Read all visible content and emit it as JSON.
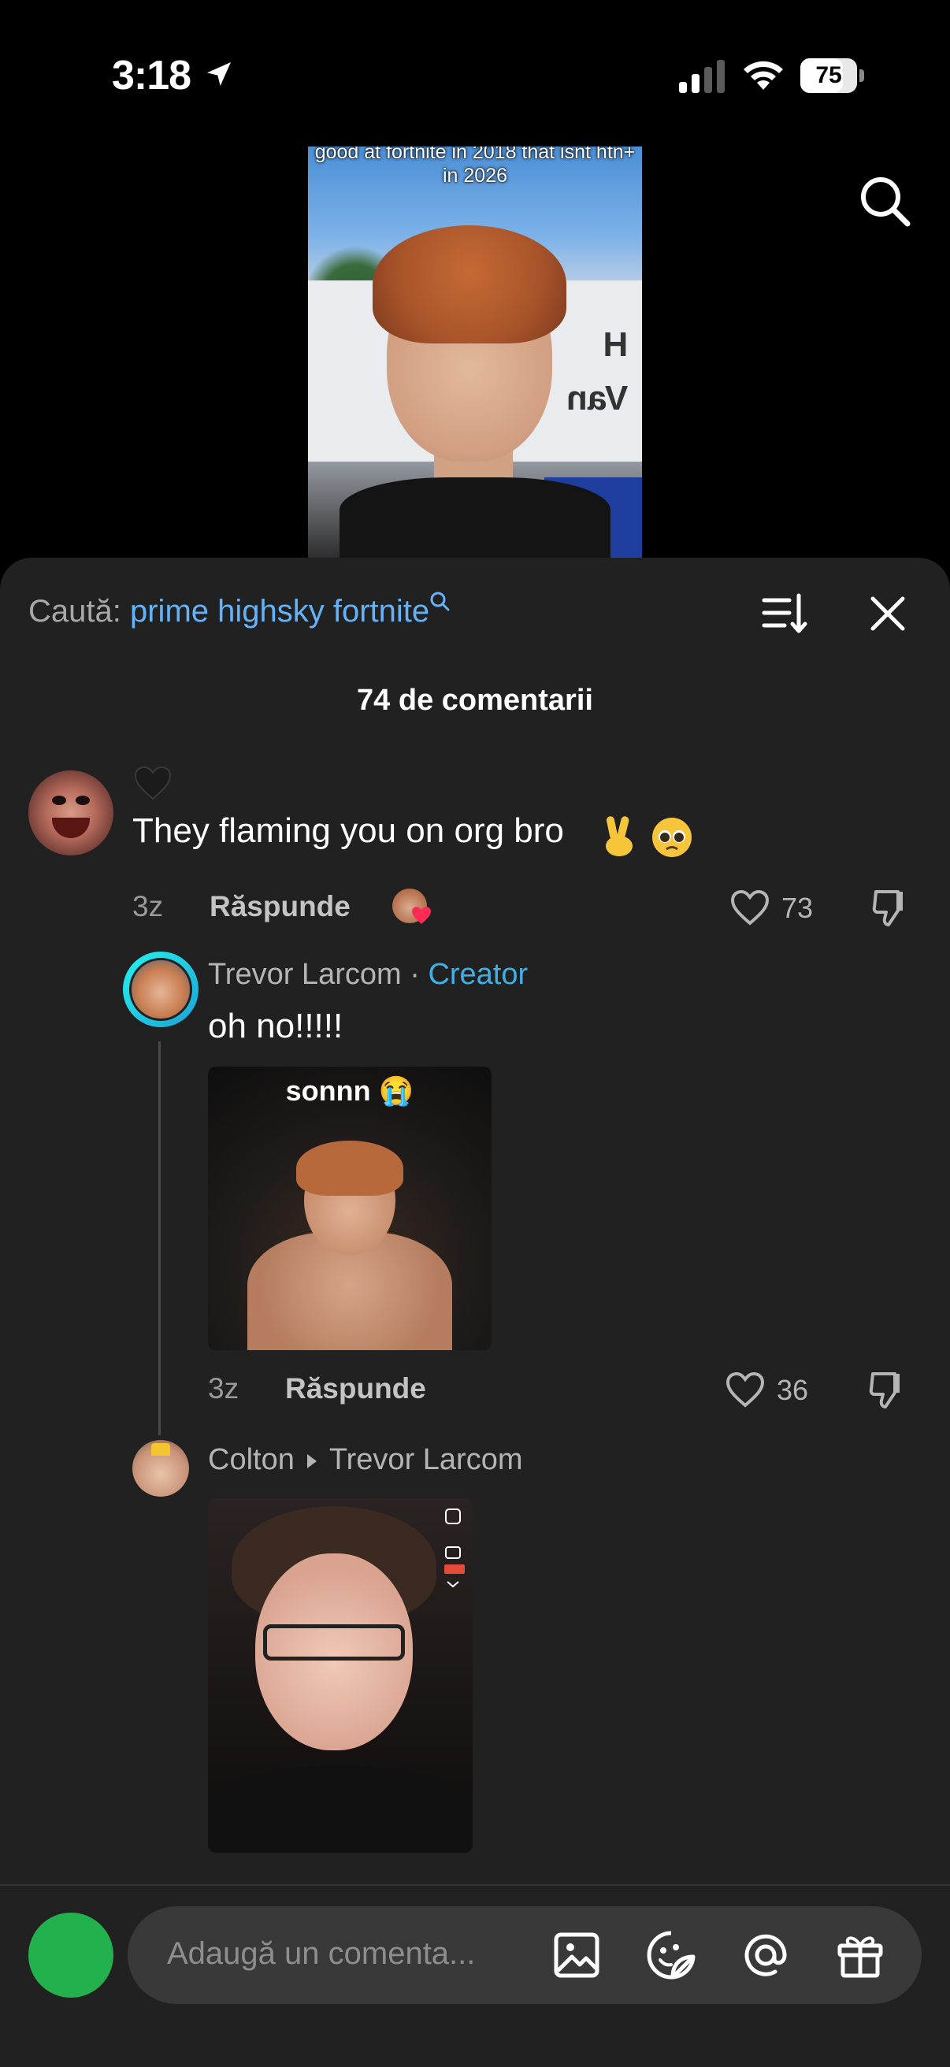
{
  "status_bar": {
    "time": "3:18",
    "battery": "75",
    "battery_level": 0.75
  },
  "video": {
    "caption": "good at fortnite in 2018 that isnt htn+ in 2026",
    "sign_letters": "H\nVan"
  },
  "search": {
    "prefix": "Caută:",
    "query": "prime highsky fortnite"
  },
  "comments_count": "74 de comentarii",
  "comments": [
    {
      "text": "They flaming you on org bro",
      "emojis": [
        "✌️",
        "🥹"
      ],
      "time": "3z",
      "reply_label": "Răspunde",
      "likes": "73",
      "creator_liked": true
    },
    {
      "author": "Trevor Larcom",
      "separator": "·",
      "badge": "Creator",
      "text": "oh no!!!!!",
      "image_caption": "sonnn 😭",
      "time": "3z",
      "reply_label": "Răspunde",
      "likes": "36"
    },
    {
      "author": "Colton",
      "reply_to": "Trevor Larcom"
    }
  ],
  "composer": {
    "placeholder": "Adaugă un comenta..."
  },
  "icons": [
    "location-arrow-icon",
    "signal-icon",
    "wifi-icon",
    "battery-icon",
    "search-icon",
    "sort-icon",
    "close-icon",
    "heart-icon",
    "dislike-icon",
    "image-icon",
    "sticker-icon",
    "mention-icon",
    "gift-icon"
  ]
}
